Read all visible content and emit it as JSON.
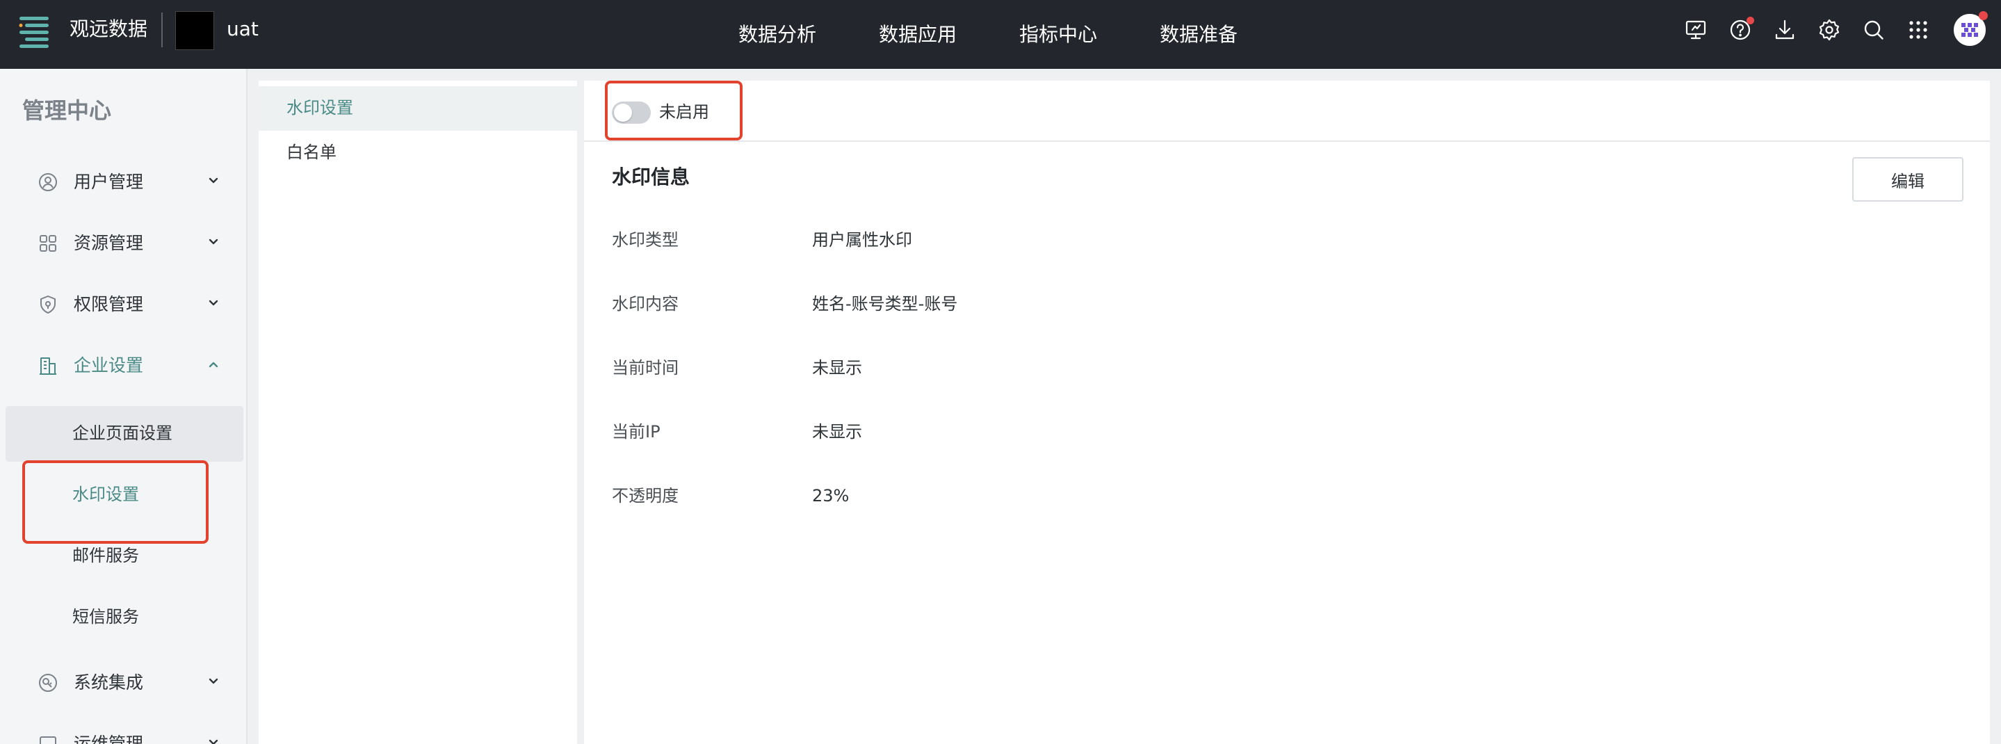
{
  "topbar": {
    "brand": "观远数据",
    "project": "uat",
    "nav": [
      "数据分析",
      "数据应用",
      "指标中心",
      "数据准备"
    ],
    "icons": [
      "monitor-icon",
      "help-icon",
      "download-icon",
      "settings-icon",
      "search-icon",
      "apps-grid-icon"
    ]
  },
  "sidebar": {
    "title": "管理中心",
    "groups": [
      {
        "label": "用户管理",
        "icon": "user-icon",
        "expanded": false
      },
      {
        "label": "资源管理",
        "icon": "resource-icon",
        "expanded": false
      },
      {
        "label": "权限管理",
        "icon": "shield-icon",
        "expanded": false
      },
      {
        "label": "企业设置",
        "icon": "building-icon",
        "expanded": true
      },
      {
        "label": "系统集成",
        "icon": "integration-icon",
        "expanded": false
      },
      {
        "label": "运维管理",
        "icon": "ops-icon",
        "expanded": false
      }
    ],
    "enterprise_items": [
      "企业页面设置",
      "水印设置",
      "邮件服务",
      "短信服务"
    ],
    "selected_item": "水印设置"
  },
  "midpanel": {
    "items": [
      "水印设置",
      "白名单"
    ],
    "active": "水印设置"
  },
  "content": {
    "toggle_label": "未启用",
    "toggle_on": false,
    "section_title": "水印信息",
    "edit_label": "编辑",
    "rows": [
      {
        "label": "水印类型",
        "value": "用户属性水印"
      },
      {
        "label": "水印内容",
        "value": "姓名-账号类型-账号"
      },
      {
        "label": "当前时间",
        "value": "未显示"
      },
      {
        "label": "当前IP",
        "value": "未显示"
      },
      {
        "label": "不透明度",
        "value": "23%"
      }
    ]
  },
  "colors": {
    "topbar_bg": "#23272d",
    "accent": "#4a8a86",
    "highlight": "#e2432f",
    "notification": "#e8474a"
  }
}
